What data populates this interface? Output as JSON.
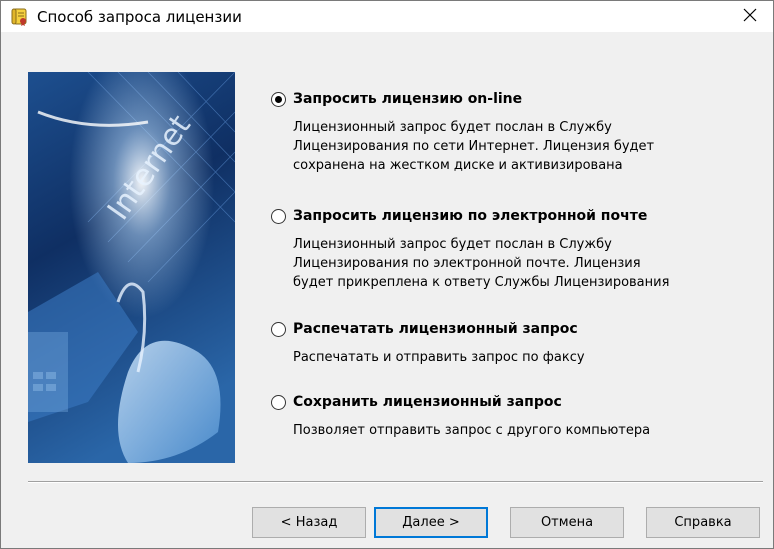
{
  "window": {
    "title": "Способ запроса лицензии"
  },
  "banner": {
    "text": "Internet"
  },
  "options": [
    {
      "label": "Запросить лицензию on-line",
      "checked": true,
      "description": [
        "Лицензионный запрос будет послан в Службу",
        "Лицензирования по сети Интернет. Лицензия будет",
        "сохранена на жестком диске и активизирована"
      ]
    },
    {
      "label": "Запросить лицензию по электронной почте",
      "checked": false,
      "description": [
        "Лицензионный запрос будет послан в Службу",
        "Лицензирования по электронной почте. Лицензия",
        "будет прикреплена к ответу Службы Лицензирования"
      ]
    },
    {
      "label": "Распечатать лицензионный запрос",
      "checked": false,
      "description": [
        "Распечатать и отправить запрос по факсу"
      ]
    },
    {
      "label": "Сохранить лицензионный запрос",
      "checked": false,
      "description": [
        "Позволяет отправить запрос с другого компьютера"
      ]
    }
  ],
  "buttons": {
    "back": "< Назад",
    "next": "Далее >",
    "cancel": "Отмена",
    "help": "Справка"
  },
  "colors": {
    "accent": "#0078d7",
    "banner_dark": "#0b2a5c",
    "banner_light": "#6fb0e8"
  }
}
